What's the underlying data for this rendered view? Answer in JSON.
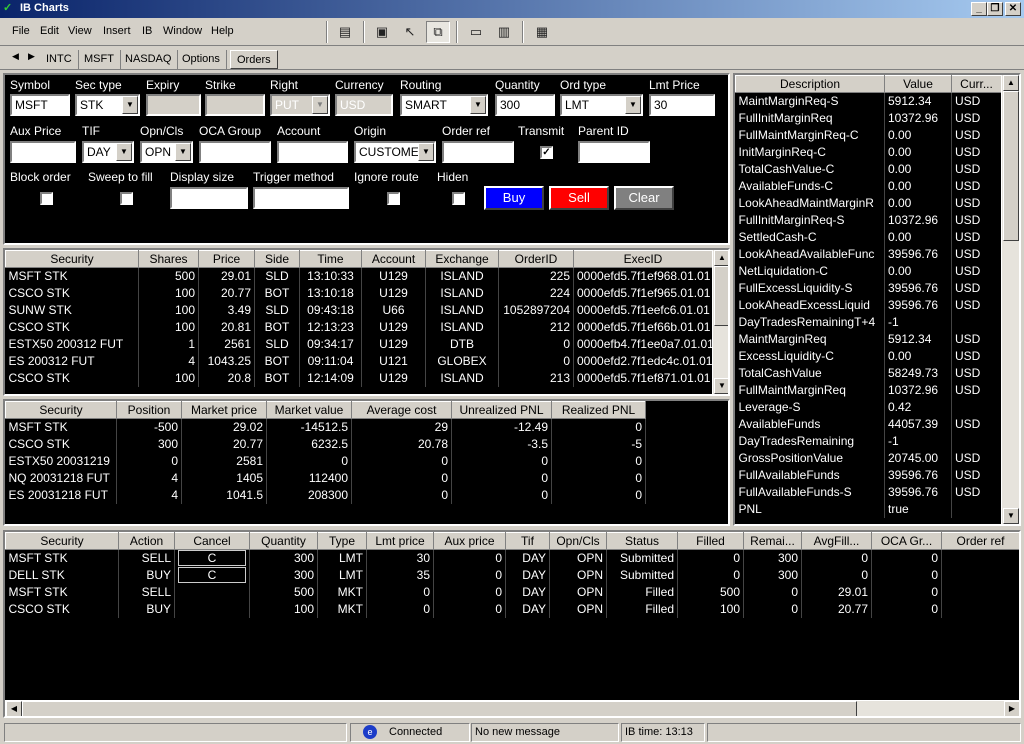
{
  "window": {
    "title": "IB Charts",
    "controls": [
      "_",
      "❐",
      "✕"
    ]
  },
  "menu": [
    "File",
    "Edit",
    "View",
    "Insert",
    "IB",
    "Window",
    "Help"
  ],
  "tabs": [
    "INTC",
    "MSFT",
    "NASDAQ",
    "Options",
    "Orders"
  ],
  "order_form": {
    "labels": {
      "symbol": "Symbol",
      "sec_type": "Sec type",
      "expiry": "Expiry",
      "strike": "Strike",
      "right": "Right",
      "currency": "Currency",
      "routing": "Routing",
      "quantity": "Quantity",
      "ord_type": "Ord type",
      "lmt_price": "Lmt Price",
      "aux_price": "Aux Price",
      "tif": "TIF",
      "opn_cls": "Opn/Cls",
      "oca_group": "OCA Group",
      "account": "Account",
      "origin": "Origin",
      "order_ref": "Order ref",
      "transmit": "Transmit",
      "parent_id": "Parent ID",
      "block_order": "Block order",
      "sweep": "Sweep to fill",
      "display_size": "Display size",
      "trigger": "Trigger method",
      "ignore_route": "Ignore route",
      "hiden": "Hiden"
    },
    "values": {
      "symbol": "MSFT",
      "sec_type": "STK",
      "expiry": "",
      "strike": "",
      "right": "PUT",
      "currency": "USD",
      "routing": "SMART",
      "quantity": "300",
      "ord_type": "LMT",
      "lmt_price": "30",
      "aux_price": "",
      "tif": "DAY",
      "opn_cls": "OPN",
      "oca_group": "",
      "account": "",
      "origin": "CUSTOMER",
      "order_ref": "",
      "transmit": true,
      "parent_id": "",
      "block_order": false,
      "sweep": false,
      "display_size": "",
      "trigger": "",
      "ignore_route": false,
      "hiden": false
    },
    "buttons": {
      "buy": "Buy",
      "sell": "Sell",
      "clear": "Clear"
    },
    "colors": {
      "buy": "#0000ff",
      "sell": "#ff0000",
      "clear": "#808080"
    }
  },
  "executions": {
    "columns": [
      "Security",
      "Shares",
      "Price",
      "Side",
      "Time",
      "Account",
      "Exchange",
      "OrderID",
      "ExecID"
    ],
    "rows": [
      [
        "MSFT STK",
        "500",
        "29.01",
        "SLD",
        "13:10:33",
        "U129",
        "ISLAND",
        "225",
        "0000efd5.7f1ef968.01.01"
      ],
      [
        "CSCO STK",
        "100",
        "20.77",
        "BOT",
        "13:10:18",
        "U129",
        "ISLAND",
        "224",
        "0000efd5.7f1ef965.01.01"
      ],
      [
        "SUNW STK",
        "100",
        "3.49",
        "SLD",
        "09:43:18",
        "U66",
        "ISLAND",
        "1052897204",
        "0000efd5.7f1eefc6.01.01"
      ],
      [
        "CSCO STK",
        "100",
        "20.81",
        "BOT",
        "12:13:23",
        "U129",
        "ISLAND",
        "212",
        "0000efd5.7f1ef66b.01.01"
      ],
      [
        "ESTX50 200312 FUT",
        "1",
        "2561",
        "SLD",
        "09:34:17",
        "U129",
        "DTB",
        "0",
        "0000efb4.7f1ee0a7.01.01"
      ],
      [
        "ES 200312 FUT",
        "4",
        "1043.25",
        "BOT",
        "09:11:04",
        "U121",
        "GLOBEX",
        "0",
        "0000efd2.7f1edc4c.01.01"
      ],
      [
        "CSCO STK",
        "100",
        "20.8",
        "BOT",
        "12:14:09",
        "U129",
        "ISLAND",
        "213",
        "0000efd5.7f1ef871.01.01"
      ]
    ]
  },
  "portfolio": {
    "columns": [
      "Security",
      "Position",
      "Market price",
      "Market value",
      "Average cost",
      "Unrealized PNL",
      "Realized PNL"
    ],
    "rows": [
      [
        "MSFT STK",
        "-500",
        "29.02",
        "-14512.5",
        "29",
        "-12.49",
        "0"
      ],
      [
        "CSCO STK",
        "300",
        "20.77",
        "6232.5",
        "20.78",
        "-3.5",
        "-5"
      ],
      [
        "ESTX50 20031219",
        "0",
        "2581",
        "0",
        "0",
        "0",
        "0"
      ],
      [
        "NQ 20031218 FUT",
        "4",
        "1405",
        "112400",
        "0",
        "0",
        "0"
      ],
      [
        "ES 20031218 FUT",
        "4",
        "1041.5",
        "208300",
        "0",
        "0",
        "0"
      ]
    ]
  },
  "account": {
    "columns": [
      "Description",
      "Value",
      "Curr..."
    ],
    "rows": [
      [
        "MaintMarginReq-S",
        "5912.34",
        "USD"
      ],
      [
        "FullInitMarginReq",
        "10372.96",
        "USD"
      ],
      [
        "FullMaintMarginReq-C",
        "0.00",
        "USD"
      ],
      [
        "InitMarginReq-C",
        "0.00",
        "USD"
      ],
      [
        "TotalCashValue-C",
        "0.00",
        "USD"
      ],
      [
        "AvailableFunds-C",
        "0.00",
        "USD"
      ],
      [
        "LookAheadMaintMarginR",
        "0.00",
        "USD"
      ],
      [
        "FullInitMarginReq-S",
        "10372.96",
        "USD"
      ],
      [
        "SettledCash-C",
        "0.00",
        "USD"
      ],
      [
        "LookAheadAvailableFunc",
        "39596.76",
        "USD"
      ],
      [
        "NetLiquidation-C",
        "0.00",
        "USD"
      ],
      [
        "FullExcessLiquidity-S",
        "39596.76",
        "USD"
      ],
      [
        "LookAheadExcessLiquid",
        "39596.76",
        "USD"
      ],
      [
        "DayTradesRemainingT+4",
        "-1",
        ""
      ],
      [
        "MaintMarginReq",
        "5912.34",
        "USD"
      ],
      [
        "ExcessLiquidity-C",
        "0.00",
        "USD"
      ],
      [
        "TotalCashValue",
        "58249.73",
        "USD"
      ],
      [
        "FullMaintMarginReq",
        "10372.96",
        "USD"
      ],
      [
        "Leverage-S",
        "0.42",
        ""
      ],
      [
        "AvailableFunds",
        "44057.39",
        "USD"
      ],
      [
        "DayTradesRemaining",
        "-1",
        ""
      ],
      [
        "GrossPositionValue",
        "20745.00",
        "USD"
      ],
      [
        "FullAvailableFunds",
        "39596.76",
        "USD"
      ],
      [
        "FullAvailableFunds-S",
        "39596.76",
        "USD"
      ],
      [
        "PNL",
        "true",
        ""
      ]
    ]
  },
  "orders": {
    "columns": [
      "Security",
      "Action",
      "Cancel",
      "Quantity",
      "Type",
      "Lmt price",
      "Aux price",
      "Tif",
      "Opn/Cls",
      "Status",
      "Filled",
      "Remai...",
      "AvgFill...",
      "OCA Gr...",
      "Order ref"
    ],
    "rows": [
      [
        "MSFT STK",
        "SELL",
        "C",
        "300",
        "LMT",
        "30",
        "0",
        "DAY",
        "OPN",
        "Submitted",
        "0",
        "300",
        "0",
        "0",
        ""
      ],
      [
        "DELL STK",
        "BUY",
        "C",
        "300",
        "LMT",
        "35",
        "0",
        "DAY",
        "OPN",
        "Submitted",
        "0",
        "300",
        "0",
        "0",
        ""
      ],
      [
        "MSFT STK",
        "SELL",
        "",
        "500",
        "MKT",
        "0",
        "0",
        "DAY",
        "OPN",
        "Filled",
        "500",
        "0",
        "29.01",
        "0",
        ""
      ],
      [
        "CSCO STK",
        "BUY",
        "",
        "100",
        "MKT",
        "0",
        "0",
        "DAY",
        "OPN",
        "Filled",
        "100",
        "0",
        "20.77",
        "0",
        ""
      ]
    ]
  },
  "status": {
    "connection": "Connected",
    "message": "No new message",
    "time": "IB time: 13:13"
  }
}
